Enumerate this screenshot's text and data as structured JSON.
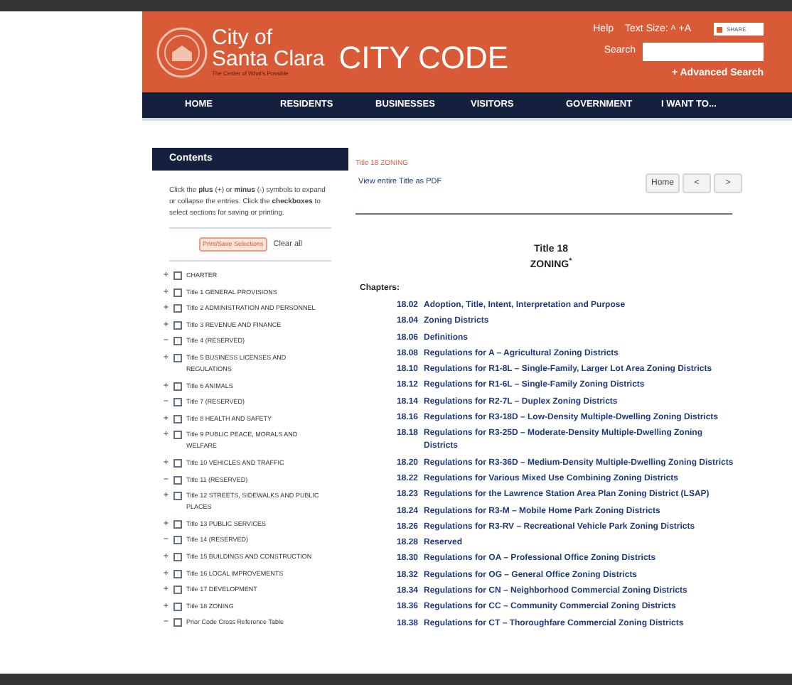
{
  "header": {
    "city_name_line1": "City of",
    "city_name_line2": "Santa Clara",
    "tagline": "The Center of What's Possible",
    "site_title": "CITY CODE",
    "help_link": "Help",
    "text_size_label": "Text Size:",
    "text_size_smaller": "A",
    "text_size_larger": "+A",
    "share_button": "SHARE",
    "search_label": "Search",
    "advanced_search": "+ Advanced Search"
  },
  "nav": [
    {
      "label": "HOME"
    },
    {
      "label": "RESIDENTS"
    },
    {
      "label": "BUSINESSES"
    },
    {
      "label": "VISITORS"
    },
    {
      "label": "GOVERNMENT"
    },
    {
      "label": "I WANT TO..."
    }
  ],
  "sidebar": {
    "title": "Contents",
    "instructions": "Click the **plus** (+) or **minus** (-) symbols to expand or collapse the entries. Click the **checkboxes** to select sections for saving or printing.",
    "print_button": "Print/Save Selections",
    "clear_link": "Clear all",
    "items": [
      {
        "sign": "+",
        "label": "CHARTER",
        "checked": false
      },
      {
        "sign": "+",
        "label": "Title 1 GENERAL PROVISIONS",
        "checked": false
      },
      {
        "sign": "+",
        "label": "Title 2 ADMINISTRATION AND PERSONNEL",
        "checked": false
      },
      {
        "sign": "+",
        "label": "Title 3 REVENUE AND FINANCE",
        "checked": false
      },
      {
        "sign": "−",
        "label": "Title 4 (RESERVED)",
        "checked": false
      },
      {
        "sign": "+",
        "label": "Title 5 BUSINESS LICENSES AND REGULATIONS",
        "checked": false
      },
      {
        "sign": "+",
        "label": "Title 6 ANIMALS",
        "checked": false
      },
      {
        "sign": "−",
        "label": "Title 7 (RESERVED)",
        "checked": false
      },
      {
        "sign": "+",
        "label": "Title 8 HEALTH AND SAFETY",
        "checked": false
      },
      {
        "sign": "+",
        "label": "Title 9 PUBLIC PEACE, MORALS AND WELFARE",
        "checked": false
      },
      {
        "sign": "+",
        "label": "Title 10 VEHICLES AND TRAFFIC",
        "checked": false
      },
      {
        "sign": "−",
        "label": "Title 11 (RESERVED)",
        "checked": false
      },
      {
        "sign": "+",
        "label": "Title 12 STREETS, SIDEWALKS AND PUBLIC PLACES",
        "checked": false
      },
      {
        "sign": "+",
        "label": "Title 13 PUBLIC SERVICES",
        "checked": false
      },
      {
        "sign": "−",
        "label": "Title 14 (RESERVED)",
        "checked": false
      },
      {
        "sign": "+",
        "label": "Title 15 BUILDINGS AND CONSTRUCTION",
        "checked": false
      },
      {
        "sign": "+",
        "label": "Title 16 LOCAL IMPROVEMENTS",
        "checked": false
      },
      {
        "sign": "+",
        "label": "Title 17 DEVELOPMENT",
        "checked": false
      },
      {
        "sign": "+",
        "label": "Title 18 ZONING",
        "checked": false
      },
      {
        "sign": "−",
        "label": "Prior Code Cross Reference Table",
        "checked": false
      }
    ]
  },
  "main": {
    "breadcrumb": "Title 18 ZONING",
    "pdf_link": "View entire Title as PDF",
    "buttons": [
      {
        "label": "Home"
      },
      {
        "label": "<"
      },
      {
        "label": ">"
      }
    ],
    "title_line1": "Title 18",
    "title_line2": "ZONING$^{*}$",
    "chapters_label": "Chapters:",
    "chapters": [
      {
        "number": "18.02",
        "title": "Adoption, Title, Intent, Interpretation and Purpose"
      },
      {
        "number": "18.04",
        "title": "Zoning Districts"
      },
      {
        "number": "18.06",
        "title": "Definitions"
      },
      {
        "number": "18.08",
        "title": "Regulations for A – Agricultural Zoning Districts"
      },
      {
        "number": "18.10",
        "title": "Regulations for R1-8L – Single-Family, Larger Lot Area Zoning Districts"
      },
      {
        "number": "18.12",
        "title": "Regulations for R1-6L – Single-Family Zoning Districts"
      },
      {
        "number": "18.14",
        "title": "Regulations for R2-7L – Duplex Zoning Districts"
      },
      {
        "number": "18.16",
        "title": "Regulations for R3-18D – Low-Density Multiple-Dwelling Zoning Districts"
      },
      {
        "number": "18.18",
        "title": "Regulations for R3-25D – Moderate-Density Multiple-Dwelling Zoning Districts"
      },
      {
        "number": "18.20",
        "title": "Regulations for R3-36D – Medium-Density Multiple-Dwelling Zoning Districts"
      },
      {
        "number": "18.22",
        "title": "Regulations for Various Mixed Use Combining Zoning Districts"
      },
      {
        "number": "18.23",
        "title": "Regulations for the Lawrence Station Area Plan Zoning District (LSAP)"
      },
      {
        "number": "18.24",
        "title": "Regulations for R3-M – Mobile Home Park Zoning Districts"
      },
      {
        "number": "18.26",
        "title": "Regulations for R3-RV – Recreational Vehicle Park Zoning Districts"
      },
      {
        "number": "18.28",
        "title": "Reserved"
      },
      {
        "number": "18.30",
        "title": "Regulations for OA – Professional Office Zoning Districts"
      },
      {
        "number": "18.32",
        "title": "Regulations for OG – General Office Zoning Districts"
      },
      {
        "number": "18.34",
        "title": "Regulations for CN – Neighborhood Commercial Zoning Districts"
      },
      {
        "number": "18.36",
        "title": "Regulations for CC – Community Commercial Zoning Districts"
      },
      {
        "number": "18.38",
        "title": "Regulations for CT – Thoroughfare Commercial Zoning Districts"
      }
    ]
  }
}
